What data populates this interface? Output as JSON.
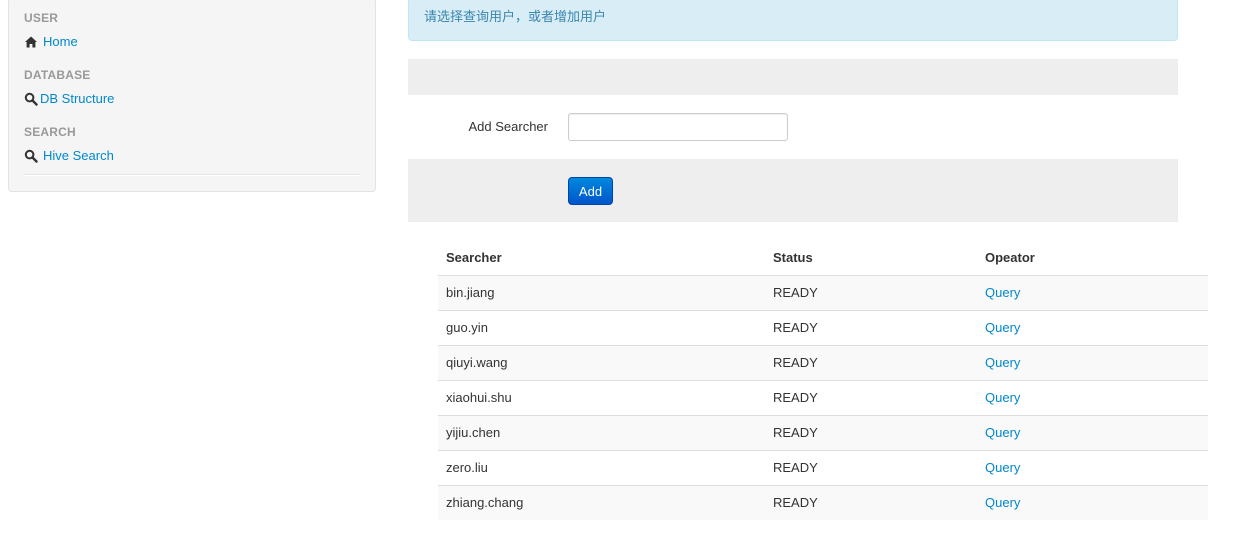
{
  "sidebar": {
    "sections": [
      {
        "header": "USER",
        "item": {
          "label": "Home",
          "icon": "home-icon"
        }
      },
      {
        "header": "DATABASE",
        "item": {
          "label": "DB Structure",
          "icon": "search-icon"
        }
      },
      {
        "header": "SEARCH",
        "item": {
          "label": "Hive Search",
          "icon": "search-icon"
        }
      }
    ]
  },
  "alert": {
    "text": "请选择查询用户，或者增加用户"
  },
  "form": {
    "label": "Add Searcher",
    "input_value": "",
    "add_label": "Add"
  },
  "table": {
    "headers": [
      "Searcher",
      "Status",
      "Opeator"
    ],
    "rows": [
      {
        "searcher": "bin.jiang",
        "status": "READY",
        "action": "Query"
      },
      {
        "searcher": "guo.yin",
        "status": "READY",
        "action": "Query"
      },
      {
        "searcher": "qiuyi.wang",
        "status": "READY",
        "action": "Query"
      },
      {
        "searcher": "xiaohui.shu",
        "status": "READY",
        "action": "Query"
      },
      {
        "searcher": "yijiu.chen",
        "status": "READY",
        "action": "Query"
      },
      {
        "searcher": "zero.liu",
        "status": "READY",
        "action": "Query"
      },
      {
        "searcher": "zhiang.chang",
        "status": "READY",
        "action": "Query"
      }
    ]
  },
  "colors": {
    "link": "#0088cc",
    "alert_bg": "#d9edf7",
    "alert_text": "#3a87ad",
    "button_primary": "#0066cc"
  }
}
